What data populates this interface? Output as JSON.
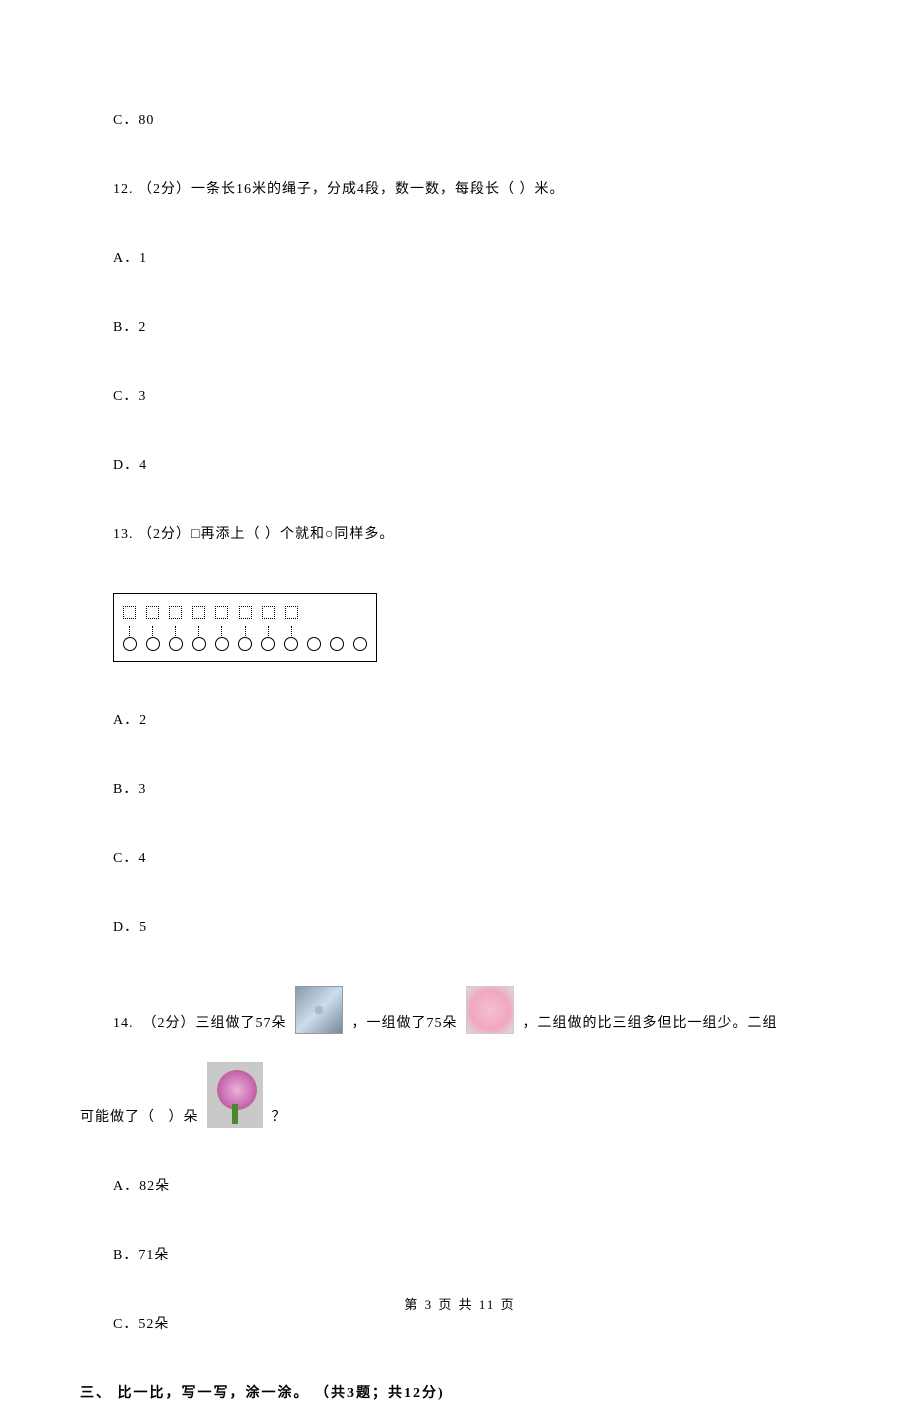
{
  "q11": {
    "optC": "C．80"
  },
  "q12": {
    "stem": "12.  （2分）一条长16米的绳子，分成4段，数一数，每段长（   ）米。",
    "optA": "A．1",
    "optB": "B．2",
    "optC": "C．3",
    "optD": "D．4"
  },
  "q13": {
    "stem": "13.  （2分）□再添上（   ）个就和○同样多。",
    "squares_count": 8,
    "circles_count": 11,
    "optA": "A．2",
    "optB": "B．3",
    "optC": "C．4",
    "optD": "D．5"
  },
  "q14": {
    "seg1": "14.  （2分）三组做了57朵 ",
    "seg2": " ，一组做了75朵 ",
    "seg3": " ，二组做的比三组多但比一组少。二组",
    "seg4": "可能做了（   ）朵 ",
    "seg5": " ？",
    "optA": "A．82朵",
    "optB": "B．71朵",
    "optC": "C．52朵"
  },
  "section3": {
    "heading": "三、 比一比，写一写，涂一涂。 （共3题；共12分)"
  },
  "footer": "第 3 页 共 11 页"
}
